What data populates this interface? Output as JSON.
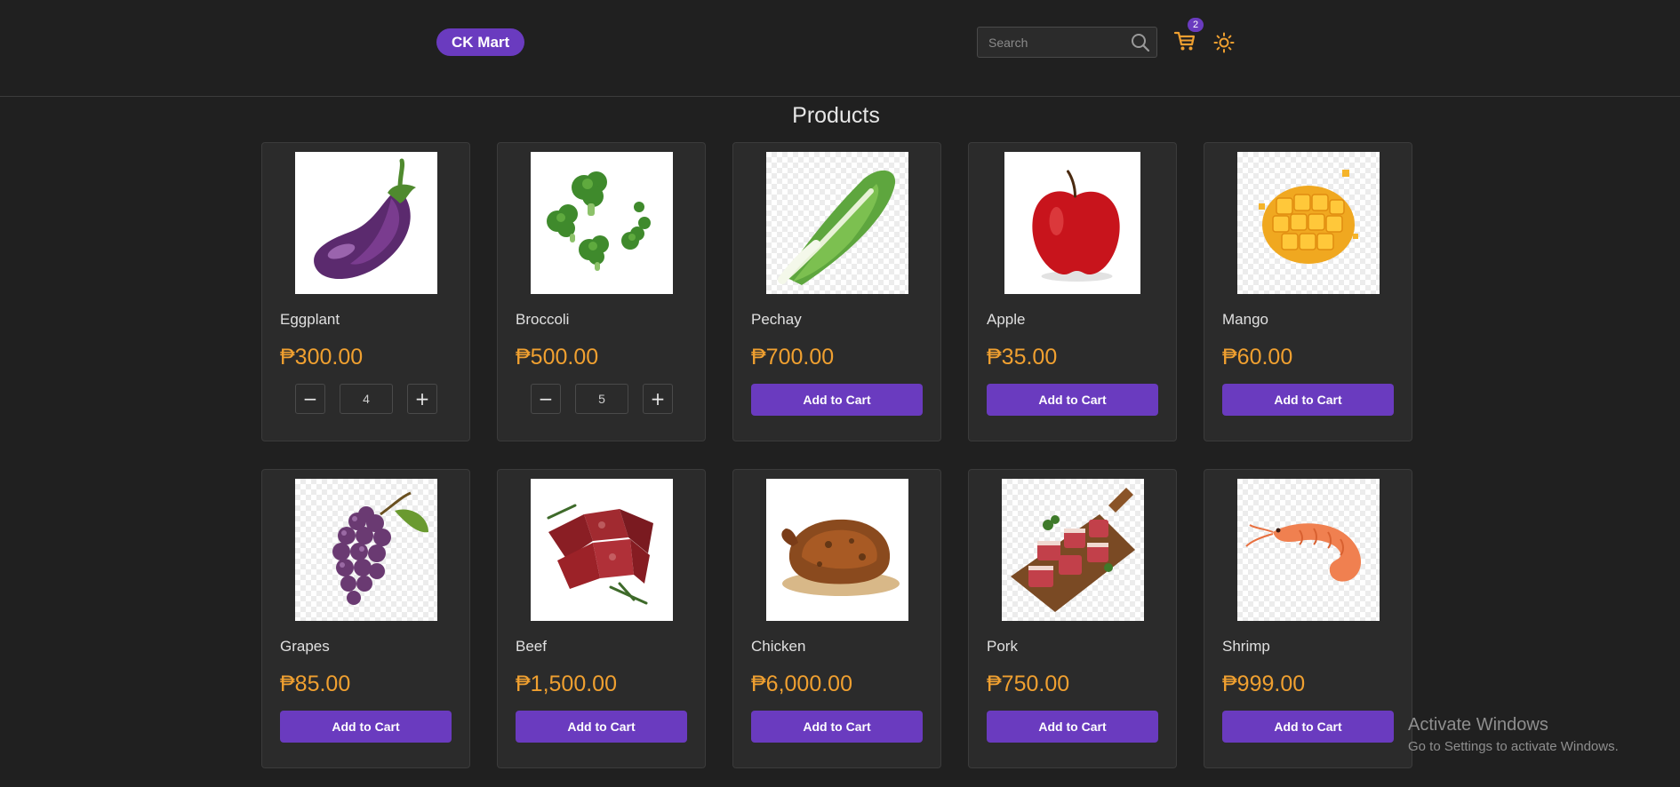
{
  "header": {
    "brand": "CK Mart",
    "search_placeholder": "Search",
    "cart_count": "2",
    "icons": [
      "search-icon",
      "cart-icon",
      "sun-icon"
    ],
    "accent_color": "#6a3bbf",
    "price_color": "#f0a030"
  },
  "main": {
    "title": "Products",
    "products": [
      {
        "name": "Eggplant",
        "price": "₱300.00",
        "in_cart": true,
        "quantity": "4"
      },
      {
        "name": "Broccoli",
        "price": "₱500.00",
        "in_cart": true,
        "quantity": "5"
      },
      {
        "name": "Pechay",
        "price": "₱700.00",
        "in_cart": false,
        "button": "Add to Cart"
      },
      {
        "name": "Apple",
        "price": "₱35.00",
        "in_cart": false,
        "button": "Add to Cart"
      },
      {
        "name": "Mango",
        "price": "₱60.00",
        "in_cart": false,
        "button": "Add to Cart"
      },
      {
        "name": "Grapes",
        "price": "₱85.00",
        "in_cart": false,
        "button": "Add to Cart"
      },
      {
        "name": "Beef",
        "price": "₱1,500.00",
        "in_cart": false,
        "button": "Add to Cart"
      },
      {
        "name": "Chicken",
        "price": "₱6,000.00",
        "in_cart": false,
        "button": "Add to Cart"
      },
      {
        "name": "Pork",
        "price": "₱750.00",
        "in_cart": false,
        "button": "Add to Cart"
      },
      {
        "name": "Shrimp",
        "price": "₱999.00",
        "in_cart": false,
        "button": "Add to Cart"
      }
    ],
    "qty_minus": "−",
    "qty_plus": "+"
  },
  "watermark": {
    "line1": "Activate Windows",
    "line2": "Go to Settings to activate Windows."
  }
}
